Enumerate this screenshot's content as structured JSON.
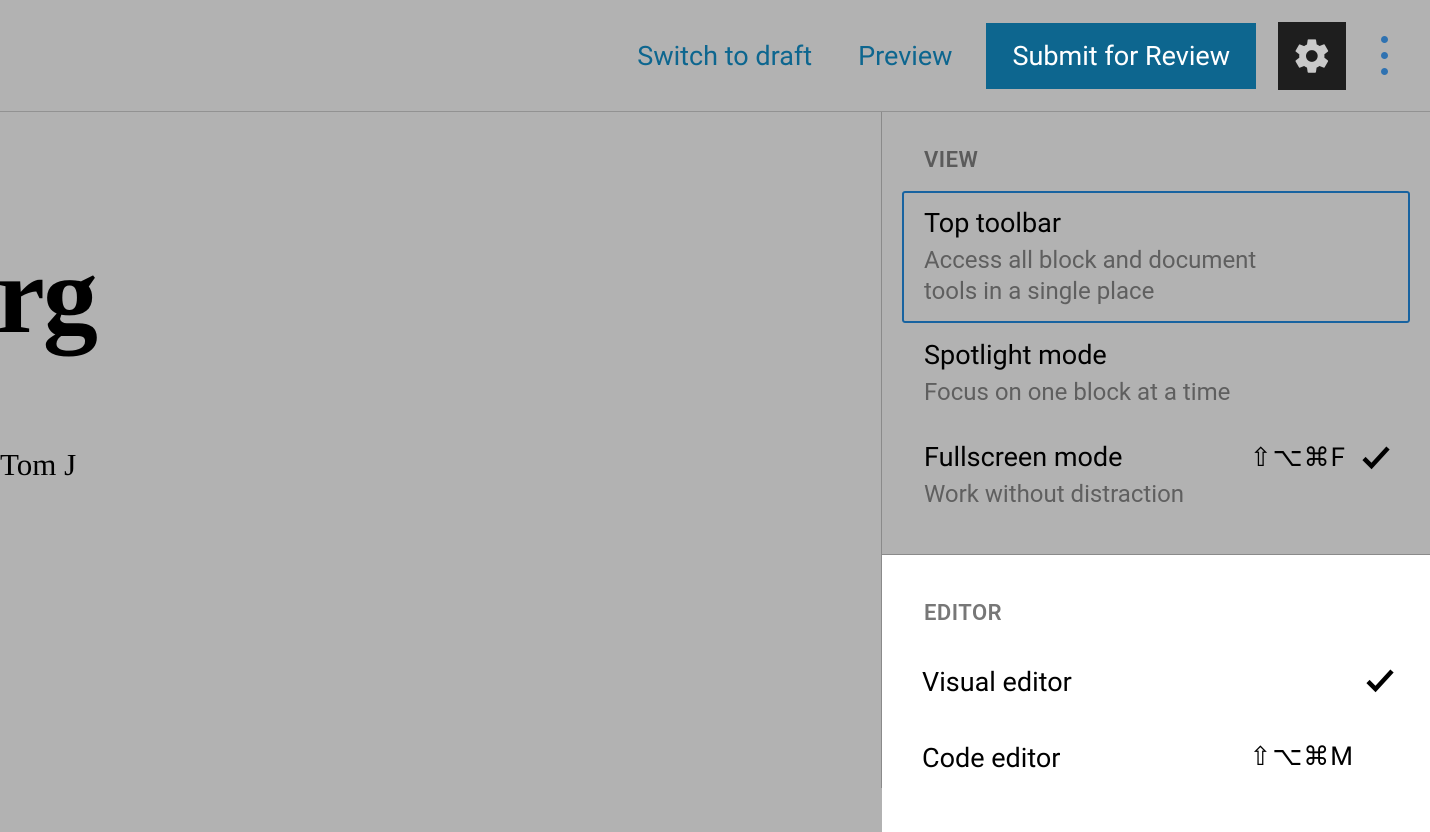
{
  "toolbar": {
    "switch_draft": "Switch to draft",
    "preview": "Preview",
    "submit": "Submit for Review"
  },
  "content": {
    "title_fragment": "rg",
    "byline": "Tom J"
  },
  "panel": {
    "view": {
      "label": "VIEW",
      "items": [
        {
          "title": "Top toolbar",
          "desc": "Access all block and document tools in a single place",
          "shortcut": "",
          "checked": false,
          "selected": true
        },
        {
          "title": "Spotlight mode",
          "desc": "Focus on one block at a time",
          "shortcut": "",
          "checked": false,
          "selected": false
        },
        {
          "title": "Fullscreen mode",
          "desc": "Work without distraction",
          "shortcut": "⇧⌥⌘F",
          "checked": true,
          "selected": false
        }
      ]
    },
    "editor": {
      "label": "EDITOR",
      "items": [
        {
          "title": "Visual editor",
          "shortcut": "",
          "checked": true
        },
        {
          "title": "Code editor",
          "shortcut": "⇧⌥⌘M",
          "checked": false
        }
      ]
    }
  }
}
